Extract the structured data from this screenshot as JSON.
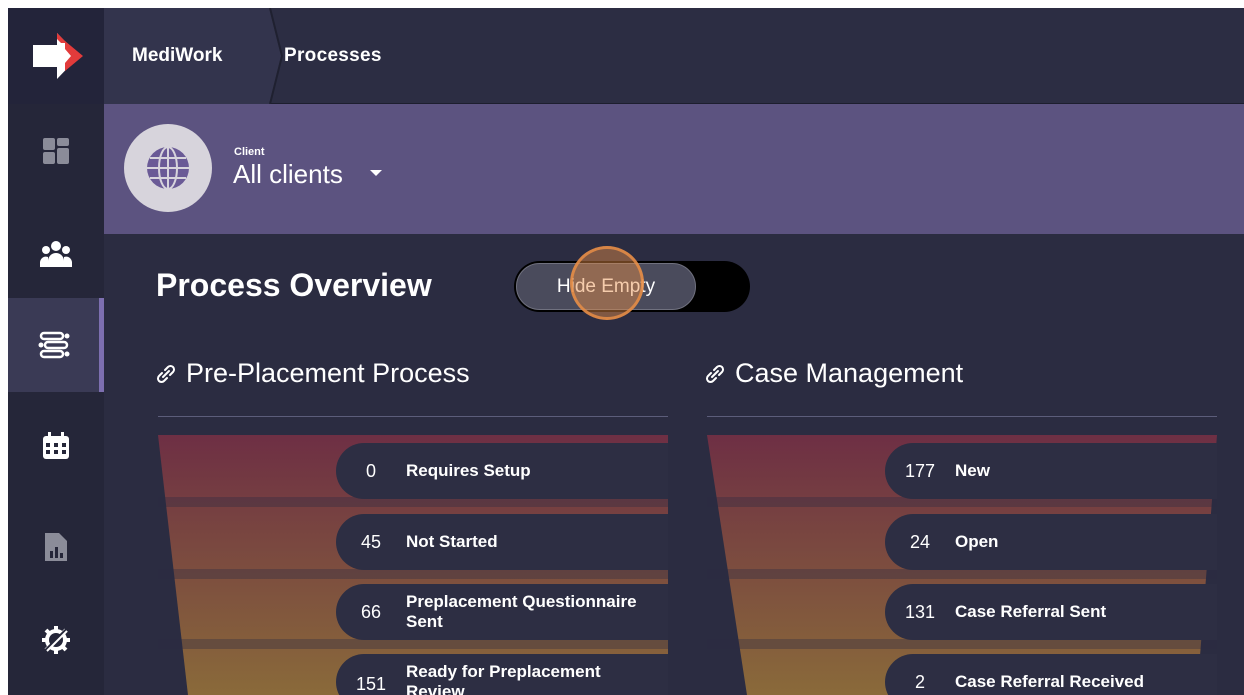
{
  "app": {
    "name": "MediWork",
    "current_page": "Processes"
  },
  "sidebar": {
    "items": [
      {
        "name": "dashboard",
        "icon": "dashboard-icon"
      },
      {
        "name": "people",
        "icon": "people-icon"
      },
      {
        "name": "processes",
        "icon": "process-icon",
        "active": true
      },
      {
        "name": "calendar",
        "icon": "calendar-icon"
      },
      {
        "name": "reports",
        "icon": "report-icon"
      },
      {
        "name": "settings",
        "icon": "settings-icon"
      }
    ]
  },
  "client_selector": {
    "label": "Client",
    "value": "All clients",
    "icon": "globe-icon"
  },
  "overview": {
    "title": "Process Overview",
    "toggle_label": "Hide Empty"
  },
  "sections": [
    {
      "title": "Pre-Placement Process",
      "icon": "link-icon",
      "stages": [
        {
          "count": "0",
          "label": "Requires Setup"
        },
        {
          "count": "45",
          "label": "Not Started"
        },
        {
          "count": "66",
          "label": "Preplacement Questionnaire Sent"
        },
        {
          "count": "151",
          "label": "Ready for Preplacement Review"
        }
      ]
    },
    {
      "title": "Case Management",
      "icon": "link-icon",
      "stages": [
        {
          "count": "177",
          "label": "New"
        },
        {
          "count": "24",
          "label": "Open"
        },
        {
          "count": "131",
          "label": "Case Referral Sent"
        },
        {
          "count": "2",
          "label": "Case Referral Received"
        }
      ]
    }
  ],
  "colors": {
    "background": "#2b2c41",
    "client_band": "#5c5380",
    "active_accent": "#7d6fb0",
    "logo_red": "#e23b3b",
    "funnel_top": "#6e2f44",
    "funnel_bottom": "#8a6a3a"
  }
}
